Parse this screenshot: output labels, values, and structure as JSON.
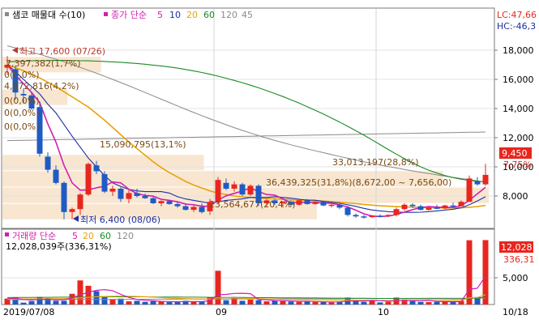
{
  "header": {
    "price_title": "샘코 매물대 수(10)",
    "ma_label": "종가 단순",
    "ma_periods": [
      "5",
      "10",
      "20",
      "60",
      "120",
      "45"
    ],
    "volume_title": "거래량 단순",
    "vol_ma_periods": [
      "5",
      "20",
      "60",
      "120"
    ],
    "lc_label": "LC:47,66",
    "hc_label": "HC:-46,3"
  },
  "colors": {
    "up": "#e8261e",
    "down": "#1f5bc4",
    "ma5": "#d11fb0",
    "ma10": "#1b2fa3",
    "ma20": "#e8a40a",
    "ma60": "#1a8a24",
    "ma120": "#8a8a8a",
    "ma45": "#8a8a8a",
    "profile": "#f7e2c9"
  },
  "annotations": {
    "high": "최고 17,600 (07/26)",
    "low": "최저 6,400 (08/06)",
    "price_label": "9,450",
    "pct_label": "7,75%",
    "vol_value": "12,028",
    "vol_pct": "336,31",
    "profile_labels": [
      "7,397,382(1,7%)",
      "0(0,0%)",
      "4,872,816(4,2%)",
      "0(0,0%)",
      "0(0,0%)",
      "0(0,0%)",
      "15,090,795(13,1%)",
      "33,013,197(28,8%)",
      "36,439,325(31,8%)(8,672,00 ~ 7,656,00)",
      "23,564,677(20,4%)"
    ],
    "volume_info": "12,028,039주(336,31%)"
  },
  "chart_data": [
    {
      "type": "candlestick",
      "title": "샘코 매물대 수(10)",
      "y_ticks": [
        8000,
        10000,
        12000,
        14000,
        16000,
        18000
      ],
      "y_tick_labels": [
        "8,000",
        "10,000",
        "12,000",
        "14,000",
        "16,000",
        "18,000"
      ],
      "x_labels": [
        {
          "i": 0,
          "label": "2019/07/08"
        },
        {
          "i": 26,
          "label": "09"
        },
        {
          "i": 46,
          "label": "10"
        },
        {
          "i": 59,
          "label": "10/18"
        }
      ],
      "candles": [
        {
          "o": 16800,
          "h": 17600,
          "l": 16300,
          "c": 17000
        },
        {
          "o": 16700,
          "h": 16900,
          "l": 14600,
          "c": 15100
        },
        {
          "o": 15000,
          "h": 15400,
          "l": 14400,
          "c": 14900
        },
        {
          "o": 14900,
          "h": 15100,
          "l": 13900,
          "c": 14000
        },
        {
          "o": 14100,
          "h": 14500,
          "l": 10700,
          "c": 10900
        },
        {
          "o": 10700,
          "h": 11000,
          "l": 9600,
          "c": 9800
        },
        {
          "o": 9800,
          "h": 10100,
          "l": 8800,
          "c": 8900
        },
        {
          "o": 8900,
          "h": 9000,
          "l": 6400,
          "c": 6900
        },
        {
          "o": 6900,
          "h": 7200,
          "l": 6400,
          "c": 7100
        },
        {
          "o": 7100,
          "h": 8200,
          "l": 6700,
          "c": 8100
        },
        {
          "o": 8100,
          "h": 10300,
          "l": 8000,
          "c": 10200
        },
        {
          "o": 10100,
          "h": 10400,
          "l": 9500,
          "c": 9700
        },
        {
          "o": 9500,
          "h": 9700,
          "l": 8200,
          "c": 8300
        },
        {
          "o": 8300,
          "h": 8700,
          "l": 8000,
          "c": 8500
        },
        {
          "o": 8500,
          "h": 8600,
          "l": 7600,
          "c": 7800
        },
        {
          "o": 7800,
          "h": 8400,
          "l": 7500,
          "c": 8200
        },
        {
          "o": 8200,
          "h": 8500,
          "l": 7900,
          "c": 8000
        },
        {
          "o": 8000,
          "h": 8150,
          "l": 7800,
          "c": 7850
        },
        {
          "o": 7850,
          "h": 7950,
          "l": 7450,
          "c": 7500
        },
        {
          "o": 7500,
          "h": 7700,
          "l": 7300,
          "c": 7650
        },
        {
          "o": 7650,
          "h": 7750,
          "l": 7400,
          "c": 7450
        },
        {
          "o": 7450,
          "h": 7600,
          "l": 7200,
          "c": 7300
        },
        {
          "o": 7300,
          "h": 7500,
          "l": 7000,
          "c": 7050
        },
        {
          "o": 7050,
          "h": 7350,
          "l": 6900,
          "c": 7250
        },
        {
          "o": 7250,
          "h": 7500,
          "l": 6800,
          "c": 6900
        },
        {
          "o": 6950,
          "h": 7800,
          "l": 6700,
          "c": 7600
        },
        {
          "o": 7600,
          "h": 9300,
          "l": 7500,
          "c": 9100
        },
        {
          "o": 8900,
          "h": 9200,
          "l": 8400,
          "c": 8500
        },
        {
          "o": 8500,
          "h": 9000,
          "l": 8300,
          "c": 8800
        },
        {
          "o": 8800,
          "h": 8900,
          "l": 8000,
          "c": 8100
        },
        {
          "o": 8100,
          "h": 8800,
          "l": 8000,
          "c": 8700
        },
        {
          "o": 8700,
          "h": 8800,
          "l": 7300,
          "c": 7500
        },
        {
          "o": 7500,
          "h": 7800,
          "l": 7300,
          "c": 7700
        },
        {
          "o": 7700,
          "h": 7800,
          "l": 7400,
          "c": 7500
        },
        {
          "o": 7500,
          "h": 7650,
          "l": 7200,
          "c": 7600
        },
        {
          "o": 7600,
          "h": 7700,
          "l": 7300,
          "c": 7400
        },
        {
          "o": 7400,
          "h": 7750,
          "l": 7350,
          "c": 7700
        },
        {
          "o": 7700,
          "h": 7800,
          "l": 7400,
          "c": 7450
        },
        {
          "o": 7450,
          "h": 7650,
          "l": 7400,
          "c": 7600
        },
        {
          "o": 7600,
          "h": 7650,
          "l": 7300,
          "c": 7350
        },
        {
          "o": 7350,
          "h": 7450,
          "l": 7200,
          "c": 7400
        },
        {
          "o": 7400,
          "h": 7500,
          "l": 7100,
          "c": 7200
        },
        {
          "o": 7200,
          "h": 7300,
          "l": 6600,
          "c": 6700
        },
        {
          "o": 6700,
          "h": 6800,
          "l": 6500,
          "c": 6600
        },
        {
          "o": 6600,
          "h": 6700,
          "l": 6450,
          "c": 6550
        },
        {
          "o": 6550,
          "h": 6700,
          "l": 6500,
          "c": 6650
        },
        {
          "o": 6650,
          "h": 6750,
          "l": 6550,
          "c": 6600
        },
        {
          "o": 6600,
          "h": 6750,
          "l": 6550,
          "c": 6700
        },
        {
          "o": 6700,
          "h": 7200,
          "l": 6600,
          "c": 7100
        },
        {
          "o": 7100,
          "h": 7500,
          "l": 7000,
          "c": 7400
        },
        {
          "o": 7400,
          "h": 7500,
          "l": 7200,
          "c": 7300
        },
        {
          "o": 7300,
          "h": 7400,
          "l": 7000,
          "c": 7050
        },
        {
          "o": 7050,
          "h": 7250,
          "l": 7000,
          "c": 7200
        },
        {
          "o": 7200,
          "h": 7400,
          "l": 7100,
          "c": 7150
        },
        {
          "o": 7150,
          "h": 7400,
          "l": 7100,
          "c": 7350
        },
        {
          "o": 7350,
          "h": 7550,
          "l": 7200,
          "c": 7300
        },
        {
          "o": 7300,
          "h": 7700,
          "l": 7300,
          "c": 7600
        },
        {
          "o": 7600,
          "h": 9400,
          "l": 7600,
          "c": 9200
        },
        {
          "o": 9000,
          "h": 9300,
          "l": 8700,
          "c": 8800
        },
        {
          "o": 8800,
          "h": 10200,
          "l": 8700,
          "c": 9450
        }
      ],
      "ma5": [
        17000,
        16300,
        15700,
        15100,
        14400,
        12950,
        11700,
        10100,
        8900,
        8400,
        8420,
        8560,
        8680,
        8960,
        8900,
        8460,
        8160,
        8040,
        7990,
        7770,
        7700,
        7600,
        7450,
        7400,
        7300,
        7290,
        7730,
        8010,
        8180,
        8340,
        8560,
        8300,
        8100,
        8060,
        7800,
        7530,
        7580,
        7540,
        7560,
        7510,
        7500,
        7390,
        7250,
        7030,
        6780,
        6620,
        6590,
        6630,
        6720,
        6900,
        7060,
        7200,
        7270,
        7240,
        7230,
        7210,
        7330,
        7700,
        8150,
        8600
      ],
      "ma10": [
        17000,
        16550,
        16000,
        15500,
        15000,
        14300,
        13700,
        12900,
        12100,
        11350,
        10600,
        10000,
        9400,
        8900,
        8650,
        8450,
        8350,
        8300,
        8300,
        8300,
        8200,
        7950,
        7800,
        7700,
        7600,
        7500,
        7600,
        7700,
        7750,
        7800,
        7900,
        7900,
        7900,
        7950,
        7900,
        7850,
        7780,
        7720,
        7710,
        7630,
        7560,
        7500,
        7400,
        7290,
        7150,
        7040,
        6980,
        6930,
        6900,
        6880,
        6880,
        6890,
        6930,
        6980,
        7040,
        7090,
        7190,
        7400,
        7660,
        7950
      ],
      "ma20": [
        17000,
        16800,
        16600,
        16350,
        16100,
        15800,
        15500,
        15150,
        14800,
        14450,
        14100,
        13650,
        13200,
        12700,
        12200,
        11700,
        11250,
        10800,
        10350,
        9950,
        9600,
        9300,
        9000,
        8750,
        8550,
        8350,
        8200,
        8100,
        8000,
        7950,
        7900,
        7850,
        7830,
        7800,
        7770,
        7740,
        7710,
        7690,
        7670,
        7650,
        7620,
        7580,
        7530,
        7480,
        7420,
        7370,
        7330,
        7300,
        7270,
        7250,
        7230,
        7210,
        7200,
        7190,
        7180,
        7180,
        7190,
        7230,
        7280,
        7350
      ],
      "ma60": [
        17200,
        17230,
        17250,
        17270,
        17280,
        17290,
        17300,
        17300,
        17290,
        17280,
        17270,
        17250,
        17230,
        17200,
        17170,
        17130,
        17090,
        17040,
        16980,
        16920,
        16850,
        16770,
        16680,
        16580,
        16470,
        16350,
        16220,
        16080,
        15930,
        15770,
        15600,
        15420,
        15230,
        15030,
        14820,
        14600,
        14370,
        14130,
        13880,
        13620,
        13350,
        13070,
        12780,
        12480,
        12170,
        11850,
        11520,
        11190,
        10870,
        10560,
        10270,
        10000,
        9770,
        9570,
        9400,
        9260,
        9150,
        9070,
        9010,
        8970
      ],
      "ma120": [
        18300,
        18160,
        18020,
        17870,
        17710,
        17550,
        17380,
        17200,
        17010,
        16820,
        16620,
        16420,
        16210,
        16000,
        15780,
        15560,
        15330,
        15100,
        14870,
        14640,
        14410,
        14180,
        13950,
        13730,
        13510,
        13300,
        13090,
        12890,
        12690,
        12500,
        12320,
        12140,
        11970,
        11810,
        11660,
        11510,
        11370,
        11230,
        11100,
        10970,
        10840,
        10710,
        10590,
        10470,
        10350,
        10240,
        10130,
        10020,
        9920,
        9820,
        9720,
        9630,
        9540,
        9450,
        9360,
        9280,
        9200,
        9120,
        9040,
        8960
      ],
      "ma45": [
        11800,
        11810,
        11820,
        11830,
        11840,
        11850,
        11860,
        11870,
        11880,
        11890,
        11900,
        11910,
        11920,
        11930,
        11940,
        11950,
        11960,
        11970,
        11980,
        11990,
        12000,
        12010,
        12020,
        12030,
        12040,
        12050,
        12060,
        12070,
        12080,
        12090,
        12100,
        12110,
        12120,
        12130,
        12140,
        12150,
        12160,
        12170,
        12180,
        12190,
        12200,
        12210,
        12220,
        12230,
        12240,
        12250,
        12260,
        12270,
        12280,
        12290,
        12300,
        12310,
        12320,
        12330,
        12340,
        12350,
        12360,
        12370,
        12380,
        12390
      ],
      "volume_profile": [
        {
          "low": 6400,
          "high": 7520,
          "volume": 23564677
        },
        {
          "low": 7520,
          "high": 8640,
          "volume": 36439325
        },
        {
          "low": 8640,
          "high": 9760,
          "volume": 33013197
        },
        {
          "low": 9760,
          "high": 10880,
          "volume": 15090795
        },
        {
          "low": 10880,
          "high": 12000,
          "volume": 0
        },
        {
          "low": 12000,
          "high": 13120,
          "volume": 0
        },
        {
          "low": 13120,
          "high": 14240,
          "volume": 0
        },
        {
          "low": 14240,
          "high": 15360,
          "volume": 4872816
        },
        {
          "low": 15360,
          "high": 16480,
          "volume": 0
        },
        {
          "low": 16480,
          "high": 17600,
          "volume": 7397382
        }
      ]
    },
    {
      "type": "bar",
      "title": "거래량 단순",
      "y_ticks": [
        5000
      ],
      "y_tick_labels": [
        "5,000"
      ],
      "volume_k": [
        1100,
        1300,
        350,
        650,
        1400,
        1200,
        700,
        700,
        2000,
        4500,
        3500,
        2500,
        1400,
        1000,
        1100,
        600,
        700,
        500,
        600,
        550,
        450,
        500,
        700,
        500,
        550,
        1300,
        6300,
        800,
        1400,
        700,
        900,
        800,
        600,
        700,
        650,
        550,
        500,
        600,
        500,
        450,
        400,
        550,
        1300,
        600,
        500,
        800,
        400,
        500,
        1300,
        900,
        700,
        500,
        450,
        500,
        600,
        500,
        700,
        12000,
        1400,
        12028
      ],
      "vol_ma5": [
        1100,
        1200,
        920,
        850,
        960,
        980,
        860,
        890,
        1200,
        1820,
        2280,
        2640,
        2780,
        2580,
        1900,
        1320,
        960,
        780,
        700,
        590,
        560,
        520,
        560,
        540,
        540,
        710,
        1870,
        1890,
        2070,
        2100,
        2020,
        920,
        880,
        740,
        730,
        660,
        600,
        600,
        560,
        520,
        490,
        500,
        640,
        660,
        670,
        750,
        720,
        620,
        700,
        780,
        760,
        760,
        770,
        610,
        550,
        510,
        550,
        2860,
        3040,
        5330
      ],
      "vol_ma20": [
        1000,
        1020,
        1040,
        1050,
        1060,
        1070,
        1080,
        1100,
        1150,
        1250,
        1350,
        1450,
        1500,
        1550,
        1560,
        1540,
        1500,
        1450,
        1380,
        1300,
        1200,
        1150,
        1100,
        1050,
        1000,
        1000,
        1250,
        1250,
        1250,
        1200,
        1150,
        1100,
        1050,
        1000,
        980,
        950,
        930,
        900,
        880,
        860,
        850,
        830,
        810,
        800,
        790,
        780,
        760,
        740,
        740,
        740,
        740,
        730,
        720,
        710,
        700,
        700,
        710,
        1270,
        1300,
        1850
      ],
      "vol_ma60": [
        1300,
        1310,
        1320,
        1330,
        1340,
        1350,
        1360,
        1370,
        1380,
        1390,
        1400,
        1410,
        1420,
        1430,
        1440,
        1440,
        1440,
        1430,
        1420,
        1410,
        1400,
        1390,
        1380,
        1370,
        1360,
        1350,
        1340,
        1330,
        1320,
        1310,
        1300,
        1290,
        1280,
        1270,
        1260,
        1250,
        1240,
        1230,
        1220,
        1210,
        1200,
        1190,
        1180,
        1170,
        1160,
        1150,
        1140,
        1130,
        1120,
        1110,
        1100,
        1090,
        1080,
        1070,
        1060,
        1050,
        1040,
        1200,
        1210,
        1400
      ],
      "vol_ma120": [
        900,
        905,
        910,
        915,
        920,
        925,
        930,
        935,
        940,
        945,
        950,
        955,
        960,
        965,
        970,
        975,
        980,
        985,
        990,
        995,
        1000,
        1005,
        1010,
        1015,
        1020,
        1025,
        1030,
        1035,
        1040,
        1045,
        1050,
        1055,
        1060,
        1065,
        1070,
        1075,
        1080,
        1085,
        1090,
        1095,
        1100,
        1105,
        1110,
        1115,
        1120,
        1125,
        1130,
        1135,
        1140,
        1145,
        1150,
        1155,
        1160,
        1165,
        1170,
        1175,
        1180,
        1185,
        1190,
        1195
      ]
    }
  ]
}
